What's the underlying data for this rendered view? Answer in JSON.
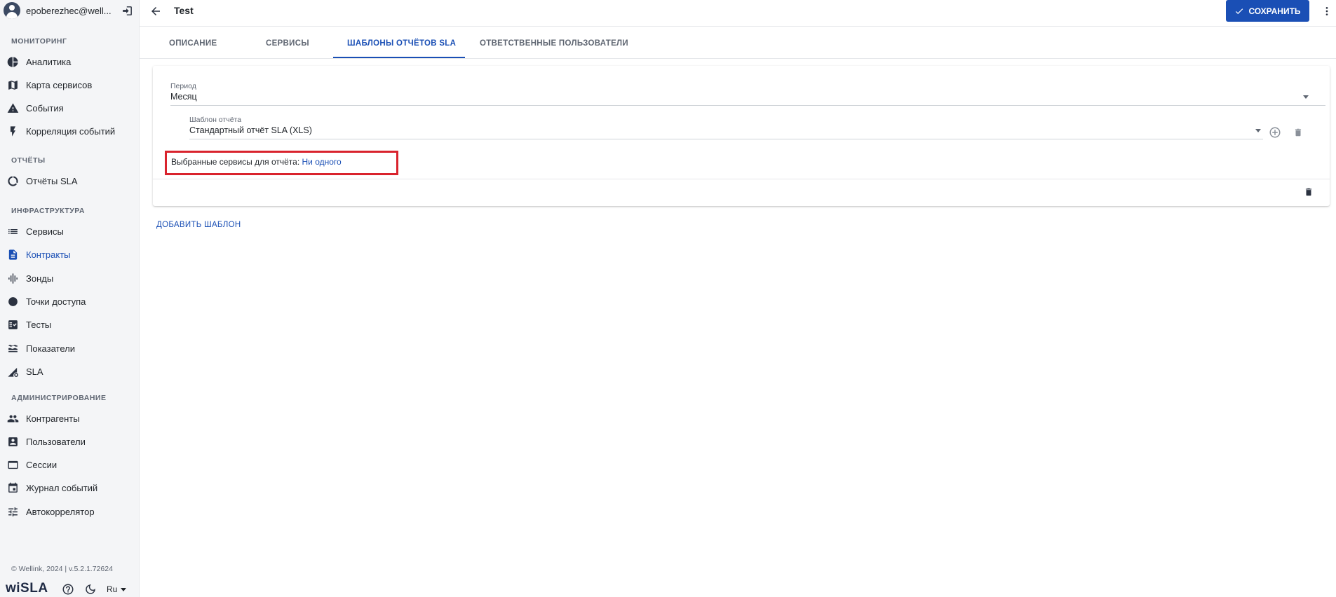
{
  "sidebar": {
    "user_name": "epoberezhec@well...",
    "sections": {
      "monitoring": "МОНИТОРИНГ",
      "reports": "ОТЧЁТЫ",
      "infrastructure": "ИНФРАСТРУКТУРА",
      "administration": "АДМИНИСТРИРОВАНИЕ"
    },
    "items": {
      "analytics": "Аналитика",
      "service_map": "Карта сервисов",
      "events": "События",
      "event_correlation": "Корреляция событий",
      "sla_reports": "Отчёты SLA",
      "services": "Сервисы",
      "contracts": "Контракты",
      "probes": "Зонды",
      "access_points": "Точки доступа",
      "tests": "Тесты",
      "metrics": "Показатели",
      "sla": "SLA",
      "counterparties": "Контрагенты",
      "users": "Пользователи",
      "sessions": "Сессии",
      "event_log": "Журнал событий",
      "autocorrelator": "Автокоррелятор"
    },
    "active_item": "contracts",
    "copyright": "© Wellink, 2024 | v.5.2.1.72624",
    "brand": "wiSLA",
    "language": "Ru"
  },
  "header": {
    "title": "Test",
    "save_label": "СОХРАНИТЬ"
  },
  "tabs": {
    "description": "ОПИСАНИЕ",
    "services": "СЕРВИСЫ",
    "sla_templates": "ШАБЛОНЫ ОТЧЁТОВ SLA",
    "responsible_users": "ОТВЕТСТВЕННЫЕ ПОЛЬЗОВАТЕЛИ",
    "active": "sla_templates"
  },
  "template_card": {
    "period_label": "Период",
    "period_value": "Месяц",
    "template_label": "Шаблон отчёта",
    "template_value": "Стандартный отчёт SLA (XLS)",
    "selected_services_label": "Выбранные сервисы для отчёта:",
    "selected_services_value": "Ни одного"
  },
  "add_template_label": "ДОБАВИТЬ ШАБЛОН",
  "colors": {
    "accent": "#1a4fb5",
    "highlight_border": "#d9232d",
    "sidebar_bg": "#f4f5f7"
  }
}
